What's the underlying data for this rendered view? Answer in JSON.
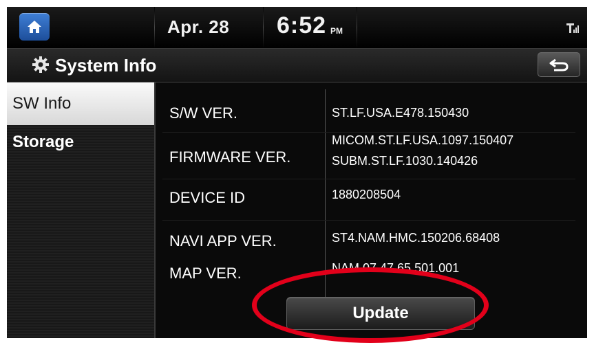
{
  "status_bar": {
    "home_icon": "home-icon",
    "date": "Apr. 28",
    "time": "6:52",
    "ampm": "PM",
    "signal_icon": "signal-icon"
  },
  "title_bar": {
    "icon": "gear-icon",
    "title": "System Info",
    "back_icon": "back-arrow-icon"
  },
  "sidebar": {
    "items": [
      {
        "label": "SW Info",
        "selected": true
      },
      {
        "label": "Storage",
        "selected": false
      }
    ]
  },
  "info": {
    "sw_ver": {
      "label": "S/W VER.",
      "value": "ST.LF.USA.E478.150430"
    },
    "firmware_ver": {
      "label": "FIRMWARE VER.",
      "values": [
        "MICOM.ST.LF.USA.1097.150407",
        "SUBM.ST.LF.1030.140426"
      ]
    },
    "device_id": {
      "label": "DEVICE ID",
      "value": "1880208504"
    },
    "navi_app_ver": {
      "label": "NAVI APP VER.",
      "value": "ST4.NAM.HMC.150206.68408"
    },
    "map_ver": {
      "label": "MAP VER.",
      "value": "NAM.07.47.65.501.001"
    }
  },
  "update_button": {
    "label": "Update"
  },
  "colors": {
    "accent_blue": "#2f66b8",
    "highlight_red": "#e2001a",
    "background": "#0a0a0a",
    "text": "#ffffff"
  }
}
